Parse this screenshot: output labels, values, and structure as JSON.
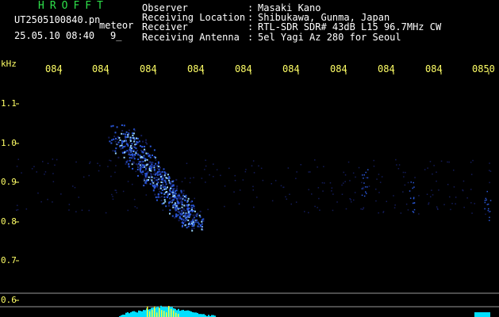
{
  "header": {
    "app_title": "HROFFT",
    "filename": "UT2505100840.pn",
    "detect_label": "meteor",
    "datetime": "25.05.10 08:40",
    "count": "9_"
  },
  "info": {
    "labels": [
      "Observer",
      "Receiving Location",
      "Receiver",
      "Receiving Antenna"
    ],
    "colons": [
      ":",
      ":",
      ":",
      ":"
    ],
    "values": [
      "Masaki Kano",
      "Shibukawa, Gunma, Japan",
      "RTL-SDR SDR# 43dB L15 96.7MHz CW",
      "5el Yagi Az 280 for Seoul"
    ]
  },
  "plot": {
    "y_unit": "kHz",
    "y_ticks": [
      "1.1",
      "1.0",
      "0.9",
      "0.8",
      "0.7",
      "0.6"
    ],
    "x_ticks": [
      "084",
      "084",
      "084",
      "084",
      "084",
      "084",
      "084",
      "084",
      "084",
      "0850"
    ],
    "colors": {
      "background": "#000000",
      "axis_text": "#ffff66",
      "title": "#2ee04a",
      "signal_strong": "#9ad8ff",
      "signal_mid": "#2a56d8",
      "signal_faint": "#141c5a",
      "bottom_band": "#00e0ff",
      "bottom_peak": "#ffff33",
      "guide_lines": "#9a9a9a"
    }
  }
}
